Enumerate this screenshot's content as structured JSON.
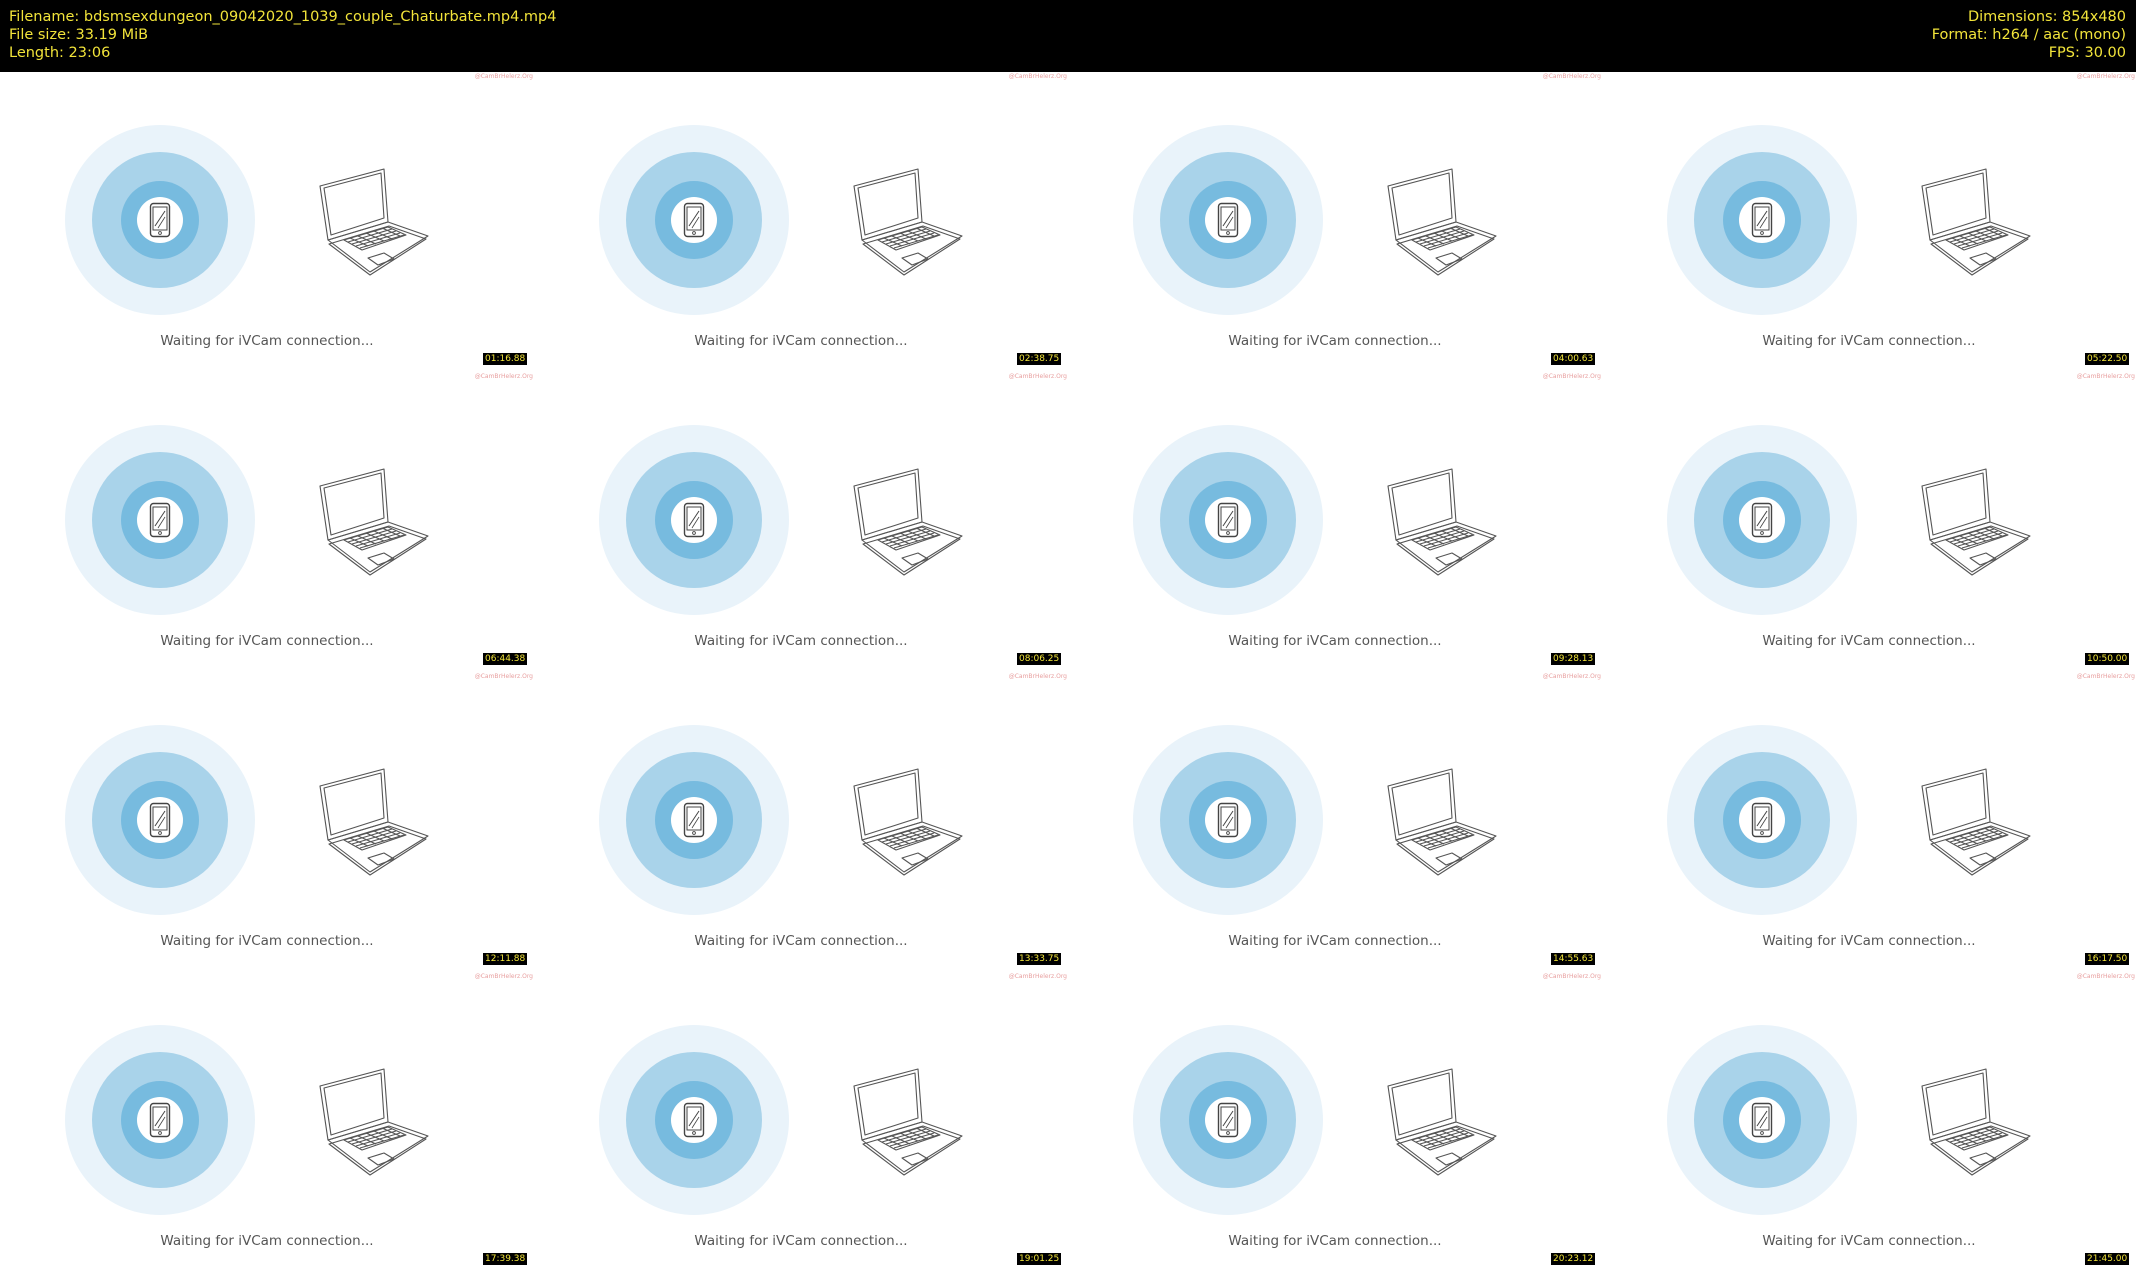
{
  "header": {
    "filename": "Filename: bdsmsexdungeon_09042020_1039_couple_Chaturbate.mp4.mp4",
    "file_size": "File size: 33.19 MiB",
    "length": "Length: 23:06",
    "dimensions": "Dimensions: 854x480",
    "format": "Format: h264 / aac (mono)",
    "fps": "FPS: 30.00"
  },
  "colors": {
    "header_bg": "#000000",
    "header_text": "#f2e43a",
    "ring_outer": "#e9f3fa",
    "ring_mid": "#a9d3ea",
    "ring_inner": "#77bbdf"
  },
  "thumbnails": [
    {
      "timestamp": "01:16.88",
      "status": "Waiting for iVCam connection...",
      "watermark": "@CamBrHelerz.Org"
    },
    {
      "timestamp": "02:38.75",
      "status": "Waiting for iVCam connection...",
      "watermark": "@CamBrHelerz.Org"
    },
    {
      "timestamp": "04:00.63",
      "status": "Waiting for iVCam connection...",
      "watermark": "@CamBrHelerz.Org"
    },
    {
      "timestamp": "05:22.50",
      "status": "Waiting for iVCam connection...",
      "watermark": "@CamBrHelerz.Org"
    },
    {
      "timestamp": "06:44.38",
      "status": "Waiting for iVCam connection...",
      "watermark": "@CamBrHelerz.Org"
    },
    {
      "timestamp": "08:06.25",
      "status": "Waiting for iVCam connection...",
      "watermark": "@CamBrHelerz.Org"
    },
    {
      "timestamp": "09:28.13",
      "status": "Waiting for iVCam connection...",
      "watermark": "@CamBrHelerz.Org"
    },
    {
      "timestamp": "10:50.00",
      "status": "Waiting for iVCam connection...",
      "watermark": "@CamBrHelerz.Org"
    },
    {
      "timestamp": "12:11.88",
      "status": "Waiting for iVCam connection...",
      "watermark": "@CamBrHelerz.Org"
    },
    {
      "timestamp": "13:33.75",
      "status": "Waiting for iVCam connection...",
      "watermark": "@CamBrHelerz.Org"
    },
    {
      "timestamp": "14:55.63",
      "status": "Waiting for iVCam connection...",
      "watermark": "@CamBrHelerz.Org"
    },
    {
      "timestamp": "16:17.50",
      "status": "Waiting for iVCam connection...",
      "watermark": "@CamBrHelerz.Org"
    },
    {
      "timestamp": "17:39.38",
      "status": "Waiting for iVCam connection...",
      "watermark": "@CamBrHelerz.Org"
    },
    {
      "timestamp": "19:01.25",
      "status": "Waiting for iVCam connection...",
      "watermark": "@CamBrHelerz.Org"
    },
    {
      "timestamp": "20:23.12",
      "status": "Waiting for iVCam connection...",
      "watermark": "@CamBrHelerz.Org"
    },
    {
      "timestamp": "21:45.00",
      "status": "Waiting for iVCam connection...",
      "watermark": "@CamBrHelerz.Org"
    }
  ]
}
